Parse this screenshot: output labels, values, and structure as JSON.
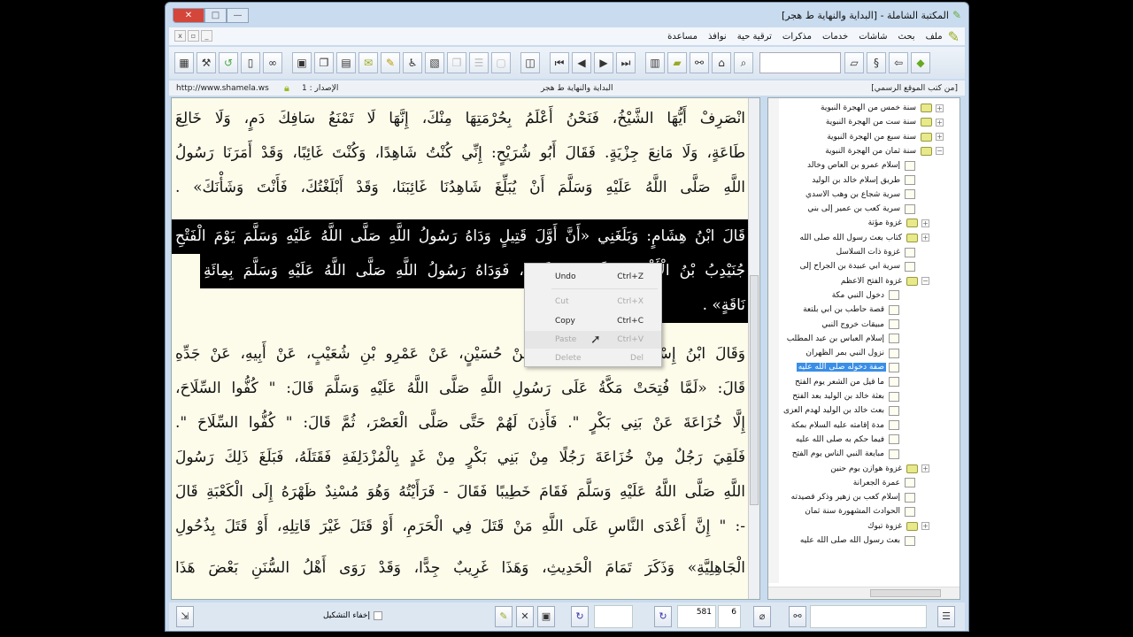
{
  "window": {
    "title": "المكتبة الشاملة - [البداية والنهاية ط هجر]",
    "controls": {
      "close": "✕",
      "maximize": "□",
      "minimize": "—"
    }
  },
  "menu": [
    "ملف",
    "بحث",
    "شاشات",
    "خدمات",
    "مذكرات",
    "ترقية حية",
    "نوافذ",
    "مساعدة"
  ],
  "mdi_controls": [
    "x",
    "▫",
    "_"
  ],
  "infobar": {
    "url": "http://www.shamela.ws",
    "version": "الإصدار : 1",
    "book": "البداية والنهاية ط هجر",
    "source": "[من كتب الموقع الرسمي]"
  },
  "text_lines": [
    "انْصَرِفْ أَيُّهَا الشَّيْخُ، فَنَحْنُ أَعْلَمُ بِحُرْمَتِهَا مِنْكَ، إِنَّهَا لَا تَمْنَعُ سَافِكَ دَمٍ، وَلَا خَالِعَ",
    "طَاعَةٍ، وَلَا مَانِعَ جِزْيَةٍ. فَقَالَ أَبُو شُرَيْحٍ: إِنِّي كُنْتُ شَاهِدًا، وَكُنْتَ غَائِبًا، وَقَدْ أَمَرَنَا رَسُولُ",
    "اللَّهِ صَلَّى اللَّهُ عَلَيْهِ وَسَلَّمَ أَنْ يُبَلِّغَ شَاهِدُنَا غَائِبَنَا، وَقَدْ أَبْلَغْتُكَ، فَأَنْتَ وَشَأْنَكَ» .",
    "قَالَ ابْنُ هِشَامٍ: وَبَلَغَنِي «أَنَّ أَوَّلَ قَتِيلٍ وَدَاهُ رَسُولُ اللَّهِ صَلَّى اللَّهُ عَلَيْهِ وَسَلَّمَ يَوْمَ الْفَتْحِ",
    "جُنَيْدِبُ بْنُ الْأَكْوَعِ، قَتَلَتْهُ بَنُو كَعْبٍ، فَوَدَاهُ رَسُولُ اللَّهِ صَلَّى اللَّهُ عَلَيْهِ وَسَلَّمَ بِمِائَةِ",
    "نَاقَةٍ» .",
    "وَقَالَ ابْنُ إِسْحَاقَ: حَدَّثَنَا يَحْيَى، عَنْ حُسَيْنٍ، عَنْ عَمْرِو بْنِ شُعَيْبٍ، عَنْ أَبِيهِ، عَنْ جَدِّهِ",
    "قَالَ: «لَمَّا فُتِحَتْ مَكَّةُ عَلَى رَسُولِ اللَّهِ صَلَّى اللَّهُ عَلَيْهِ وَسَلَّمَ قَالَ: \" كُفُّوا السِّلَاحَ،",
    "إِلَّا خُزَاعَةَ عَنْ بَنِي بَكْرٍ \". فَأَذِنَ لَهُمْ حَتَّى صَلَّى الْعَصْرَ، ثُمَّ قَالَ: \" كُفُّوا السِّلَاحَ \".",
    "فَلَقِيَ رَجُلٌ مِنْ خُزَاعَةَ رَجُلًا مِنْ بَنِي بَكْرٍ مِنْ غَدٍ بِالْمُزْدَلِفَةِ فَقَتَلَهُ، فَبَلَغَ ذَلِكَ رَسُولَ",
    "اللَّهِ صَلَّى اللَّهُ عَلَيْهِ وَسَلَّمَ فَقَامَ خَطِيبًا فَقَالَ - فَرَأَيْتُهُ وَهُوَ مُسْنِدٌ ظَهْرَهُ إِلَى الْكَعْبَةِ قَالَ",
    "-: \" إِنَّ أَعْدَى النَّاسِ عَلَى اللَّهِ مَنْ قَتَلَ فِي الْحَرَمِ، أَوْ قَتَلَ غَيْرَ قَاتِلِهِ، أَوْ قَتَلَ بِذُحُولِ",
    "الْجَاهِلِيَّةِ» وَذَكَرَ تَمَامَ الْحَدِيثِ، وَهَذَا غَرِيبٌ جِدًّا، وَقَدْ رَوَى أَهْلُ السُّنَنِ بَعْضَ هَذَا"
  ],
  "context_menu": [
    {
      "label": "Undo",
      "shortcut": "Ctrl+Z",
      "enabled": true
    },
    {
      "label": "Cut",
      "shortcut": "Ctrl+X",
      "enabled": false
    },
    {
      "label": "Copy",
      "shortcut": "Ctrl+C",
      "enabled": true
    },
    {
      "label": "Paste",
      "shortcut": "Ctrl+V",
      "enabled": false
    },
    {
      "label": "Delete",
      "shortcut": "Del",
      "enabled": false
    }
  ],
  "tree": [
    {
      "label": "سنة خمس من الهجرة النبوية",
      "level": 0,
      "type": "folder",
      "exp": "+"
    },
    {
      "label": "سنة ست من الهجرة النبوية",
      "level": 0,
      "type": "folder",
      "exp": "+"
    },
    {
      "label": "سنة سبع من الهجرة النبوية",
      "level": 0,
      "type": "folder",
      "exp": "+"
    },
    {
      "label": "سنة ثمان من الهجرة النبوية",
      "level": 0,
      "type": "folder",
      "exp": "−"
    },
    {
      "label": "إسلام عمرو بن العاص وخالد",
      "level": 1,
      "type": "page"
    },
    {
      "label": "طريق إسلام خالد بن الوليد",
      "level": 1,
      "type": "page"
    },
    {
      "label": "سرية شجاع بن وهب الأسدي",
      "level": 1,
      "type": "page"
    },
    {
      "label": "سرية كعب بن عمير إلى بني",
      "level": 1,
      "type": "page"
    },
    {
      "label": "غزوة مؤتة",
      "level": 1,
      "type": "folder",
      "exp": "+"
    },
    {
      "label": "كتاب بعث رسول الله صلى الله",
      "level": 1,
      "type": "folder",
      "exp": "+"
    },
    {
      "label": "غزوة ذات السلاسل",
      "level": 1,
      "type": "page"
    },
    {
      "label": "سرية أبي عبيدة بن الجراح إلى",
      "level": 1,
      "type": "page"
    },
    {
      "label": "غزوة الفتح الأعظم",
      "level": 1,
      "type": "folder",
      "exp": "−"
    },
    {
      "label": "دخول النبي مكة",
      "level": 2,
      "type": "page"
    },
    {
      "label": "قصة حاطب بن أبي بلتعة",
      "level": 2,
      "type": "page"
    },
    {
      "label": "مبيقات خروج النبي",
      "level": 2,
      "type": "page"
    },
    {
      "label": "إسلام العباس بن عبد المطلب",
      "level": 2,
      "type": "page"
    },
    {
      "label": "نزول النبي بمر الظهران",
      "level": 2,
      "type": "page"
    },
    {
      "label": "صفة دخوله صلى الله عليه",
      "level": 2,
      "type": "page",
      "selected": true
    },
    {
      "label": "ما قيل من الشعر يوم الفتح",
      "level": 2,
      "type": "page"
    },
    {
      "label": "بعثة خالد بن الوليد بعد الفتح",
      "level": 2,
      "type": "page"
    },
    {
      "label": "بعث خالد بن الوليد لهدم العزى",
      "level": 2,
      "type": "page"
    },
    {
      "label": "مدة إقامته عليه السلام بمكة",
      "level": 2,
      "type": "page"
    },
    {
      "label": "فيما حكم به صلى الله عليه",
      "level": 2,
      "type": "page"
    },
    {
      "label": "مبايعة النبي الناس يوم الفتح",
      "level": 2,
      "type": "page"
    },
    {
      "label": "غزوة هوازن يوم حنين",
      "level": 1,
      "type": "folder",
      "exp": "+"
    },
    {
      "label": "عمرة الجعرانة",
      "level": 1,
      "type": "page"
    },
    {
      "label": "إسلام كعب بن زهير وذكر قصيدته",
      "level": 1,
      "type": "page"
    },
    {
      "label": "الحوادث المشهورة سنة ثمان",
      "level": 1,
      "type": "page"
    },
    {
      "label": "غزوة تبوك",
      "level": 1,
      "type": "folder",
      "exp": "+"
    },
    {
      "label": "بعث رسول الله صلى الله عليه",
      "level": 1,
      "type": "page"
    }
  ],
  "bottom": {
    "hide_diacritics": "إخفاء التشكيل",
    "page": "581",
    "part": "6"
  },
  "colors": {
    "paper": "#fdfbea",
    "selection": "#000000",
    "tree_selection": "#3a8ee6"
  }
}
